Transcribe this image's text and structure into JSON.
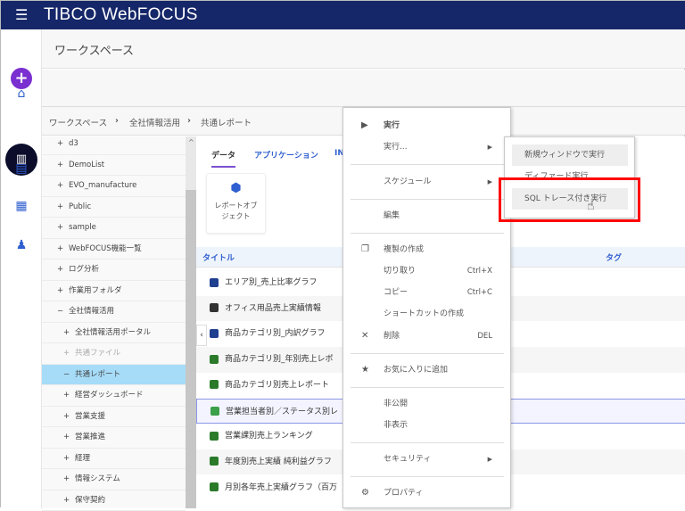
{
  "topbar": {
    "menu_icon": "hamburger-icon",
    "logo": "TIBCO WebFOCUS"
  },
  "rail": {
    "items": [
      "plus-icon",
      "home-icon",
      "workspace-icon",
      "folder-data-icon",
      "portal-icon",
      "user-settings-icon"
    ]
  },
  "header": {
    "title": "ワークスペース"
  },
  "breadcrumb": [
    "ワークスペース",
    "全社情報活用",
    "共通レポート"
  ],
  "tree": [
    {
      "sign": "+",
      "label": "d3",
      "level": 0
    },
    {
      "sign": "+",
      "label": "DemoList",
      "level": 0
    },
    {
      "sign": "+",
      "label": "EVO_manufacture",
      "level": 0
    },
    {
      "sign": "+",
      "label": "Public",
      "level": 0
    },
    {
      "sign": "+",
      "label": "sample",
      "level": 0
    },
    {
      "sign": "+",
      "label": "WebFOCUS機能一覧",
      "level": 0
    },
    {
      "sign": "+",
      "label": "ログ分析",
      "level": 0
    },
    {
      "sign": "+",
      "label": "作業用フォルダ",
      "level": 0
    },
    {
      "sign": "−",
      "label": "全社情報活用",
      "level": 0
    },
    {
      "sign": "+",
      "label": "全社情報活用ポータル",
      "level": 1
    },
    {
      "sign": "+",
      "label": "共通ファイル",
      "level": 1
    },
    {
      "sign": "−",
      "label": "共通レポート",
      "level": 1
    },
    {
      "sign": "+",
      "label": "経営ダッシュボード",
      "level": 1
    },
    {
      "sign": "+",
      "label": "営業支援",
      "level": 1
    },
    {
      "sign": "+",
      "label": "営業推進",
      "level": 1
    },
    {
      "sign": "+",
      "label": "経理",
      "level": 1
    },
    {
      "sign": "+",
      "label": "情報システム",
      "level": 1
    },
    {
      "sign": "+",
      "label": "保守契約",
      "level": 1
    }
  ],
  "tabs": [
    "データ",
    "アプリケーション",
    "IN"
  ],
  "tile": {
    "label": "レポートオブジェクト",
    "icon": "cube-icon"
  },
  "table": {
    "headers": [
      "タイトル",
      "タグ"
    ],
    "rows": [
      {
        "title": "エリア別_売上比率グラフ",
        "icon": "chart-icon"
      },
      {
        "title": "オフィス用品売上実績情報",
        "icon": "report-icon"
      },
      {
        "title": "商品カテゴリ別_内訳グラフ",
        "icon": "chart-icon"
      },
      {
        "title": "商品カテゴリ別_年別売上レポ",
        "icon": "infoassist-icon"
      },
      {
        "title": "商品カテゴリ別売上レポート",
        "icon": "infoassist-icon"
      },
      {
        "title": "営業担当者別／ステータス別レ",
        "icon": "sheet-icon"
      },
      {
        "title": "営業課別売上ランキング",
        "icon": "infoassist-icon"
      },
      {
        "title": "年度別売上実績 純利益グラフ",
        "icon": "infoassist-icon"
      },
      {
        "title": "月別各年売上実績グラフ（百万",
        "icon": "infoassist-icon"
      }
    ]
  },
  "context_menu": {
    "run": "実行",
    "run_as": "実行...",
    "schedule": "スケジュール",
    "edit": "編集",
    "duplicate": "複製の作成",
    "cut": "切り取り",
    "cut_shortcut": "Ctrl+X",
    "copy": "コピー",
    "copy_shortcut": "Ctrl+C",
    "shortcut": "ショートカットの作成",
    "delete": "削除",
    "delete_shortcut": "DEL",
    "favorite": "お気に入りに追加",
    "unpublish": "非公開",
    "hide": "非表示",
    "security": "セキュリティ",
    "properties": "プロパティ"
  },
  "submenu": {
    "new_window": "新規ウィンドウで実行",
    "deferred": "ディファード実行",
    "sql_trace": "SQL トレース付き実行"
  },
  "colors": {
    "topbar": "#162769",
    "highlight": "#ff0000",
    "selected_tree": "#a6dcf8",
    "accent": "#2f5fd0"
  }
}
